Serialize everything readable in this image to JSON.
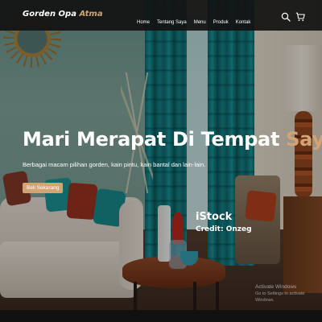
{
  "navbar": {
    "brand": {
      "main": "Gorden Opa ",
      "accent": "Atma"
    },
    "menu": [
      {
        "label": "Home"
      },
      {
        "label": "Tentang Saya"
      },
      {
        "label": "Menu"
      },
      {
        "label": "Produk"
      },
      {
        "label": "Kontak"
      }
    ],
    "icons": [
      "search-icon",
      "cart-icon"
    ]
  },
  "hero": {
    "title_main": "Mari Merapat Di Tempat ",
    "title_accent": "Saya",
    "subtitle": "Berbagai macam pilihan gorden, kain pintu, kain bantal dan lain-lain.",
    "button_label": "Beli Sekarang"
  },
  "credit": {
    "source": "iStock",
    "author": "Credit: Onzeg"
  },
  "watermark": {
    "title": "Activate Windows",
    "subtitle": "Go to Settings to activate Windows."
  },
  "colors": {
    "accent": "#d4a373",
    "navbar_bg": "#121212",
    "text": "#ffffff"
  }
}
